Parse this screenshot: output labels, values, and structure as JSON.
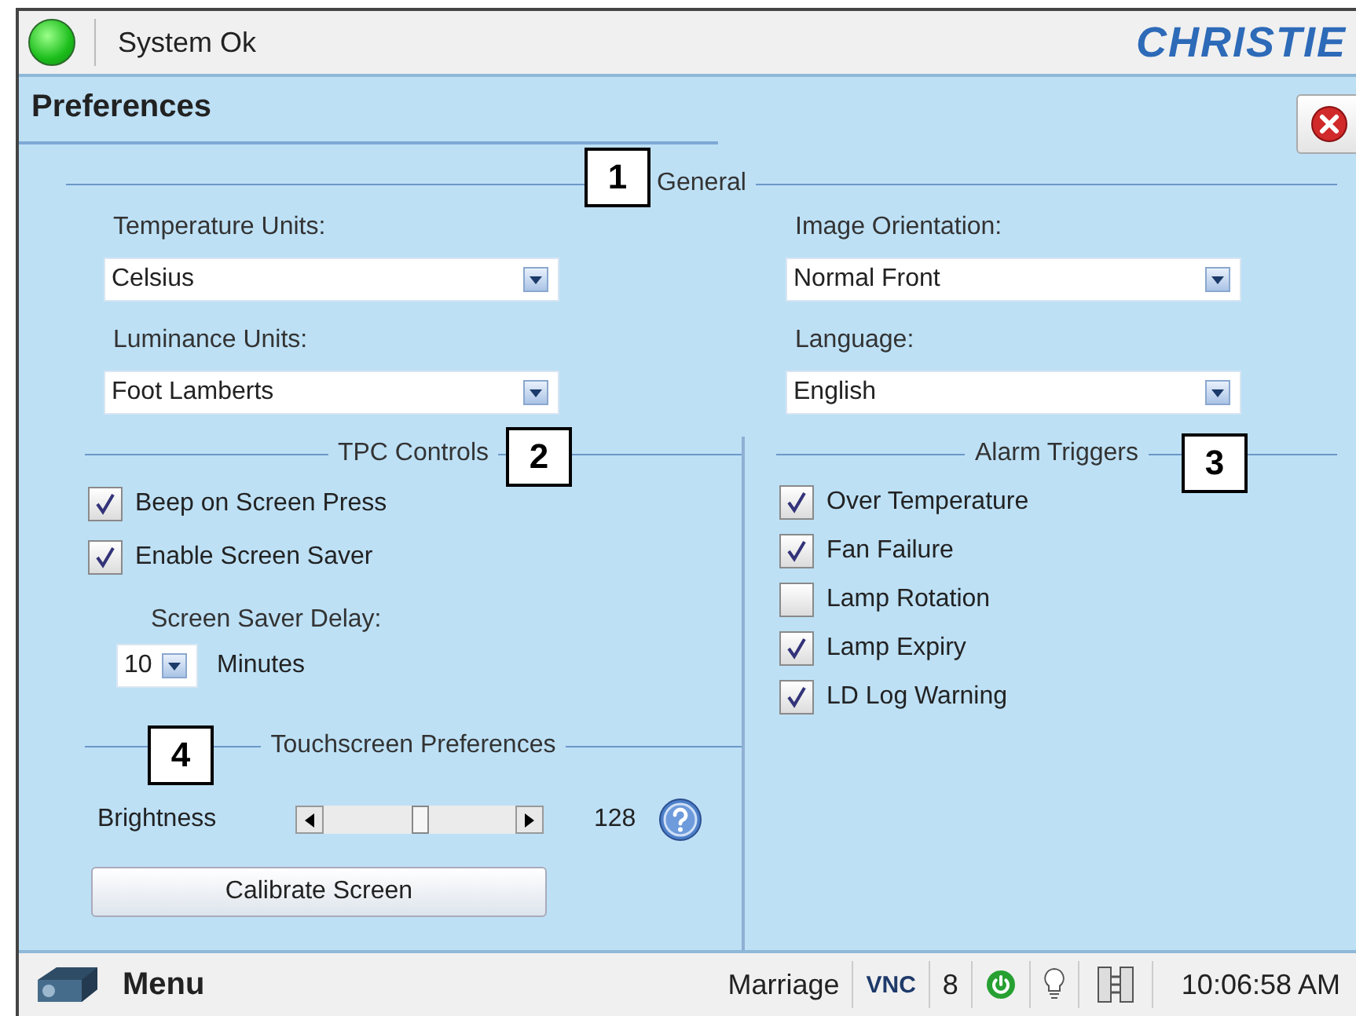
{
  "header": {
    "status": "System Ok",
    "logo": "CHRISTIE"
  },
  "panel": {
    "title": "Preferences"
  },
  "general": {
    "heading": "General",
    "fields": [
      {
        "label": "Temperature Units:",
        "value": "Celsius"
      },
      {
        "label": "Image Orientation:",
        "value": "Normal Front"
      },
      {
        "label": "Luminance Units:",
        "value": "Foot Lamberts"
      },
      {
        "label": "Language:",
        "value": "English"
      }
    ]
  },
  "tpc_controls": {
    "heading": "TPC Controls",
    "options": [
      {
        "label": "Beep on Screen Press",
        "checked": true
      },
      {
        "label": "Enable Screen Saver",
        "checked": true
      }
    ],
    "delay_label": "Screen Saver Delay:",
    "delay_value": "10",
    "delay_unit": "Minutes"
  },
  "touchscreen": {
    "heading": "Touchscreen Preferences",
    "brightness_label": "Brightness",
    "level": 0.5,
    "reading": "128",
    "button": "Calibrate Screen"
  },
  "alarm_triggers": {
    "heading": "Alarm Triggers",
    "options": [
      {
        "label": "Over Temperature",
        "checked": true
      },
      {
        "label": "Fan Failure",
        "checked": true
      },
      {
        "label": "Lamp Rotation",
        "checked": false
      },
      {
        "label": "Lamp Expiry",
        "checked": true
      },
      {
        "label": "LD Log Warning",
        "checked": true
      }
    ]
  },
  "callouts": [
    "1",
    "2",
    "3",
    "4"
  ],
  "status_bar": {
    "menu": "Menu",
    "user": "Marriage",
    "vnc": "VNC",
    "count": "8",
    "time": "10:06:58 AM"
  }
}
